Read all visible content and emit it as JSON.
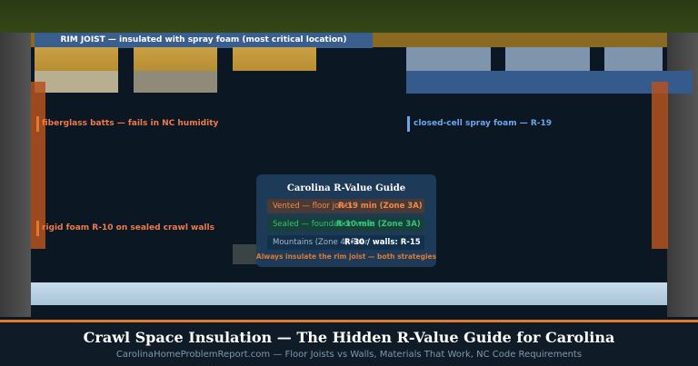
{
  "labels": {
    "rim": "RIM JOIST — insulated with spray foam (most critical location)",
    "fiberglass": "fiberglass batts — fails in NC humidity",
    "closed_cell": "closed-cell spray foam — R-19",
    "rigid_foam": "rigid foam R-10 on sealed crawl walls"
  },
  "guide": {
    "title": "Carolina R-Value Guide",
    "rows": [
      {
        "label": "Vented — floor joists",
        "value": "R-19 min (Zone 3A)",
        "color": "#f08a4b"
      },
      {
        "label": "Sealed — foundation walls",
        "value": "R-10 min (Zone 3A)",
        "color": "#35c27a"
      },
      {
        "label": "Mountains (Zone 4) floor",
        "value": "R-30 / walls: R-15",
        "color": "#ffffff"
      }
    ],
    "note": "Always insulate the rim joist — both strategies"
  },
  "footer": {
    "title": "Crawl Space Insulation — The Hidden R-Value Guide for Carolina",
    "subtitle": "CarolinaHomeProblemReport.com — Floor Joists vs Walls, Materials That Work, NC Code Requirements"
  },
  "colors": {
    "accent_orange": "#e07a2e",
    "fiberglass_text": "#f07a4a",
    "spray_text": "#6ea6ee",
    "background": "#0b1722"
  }
}
